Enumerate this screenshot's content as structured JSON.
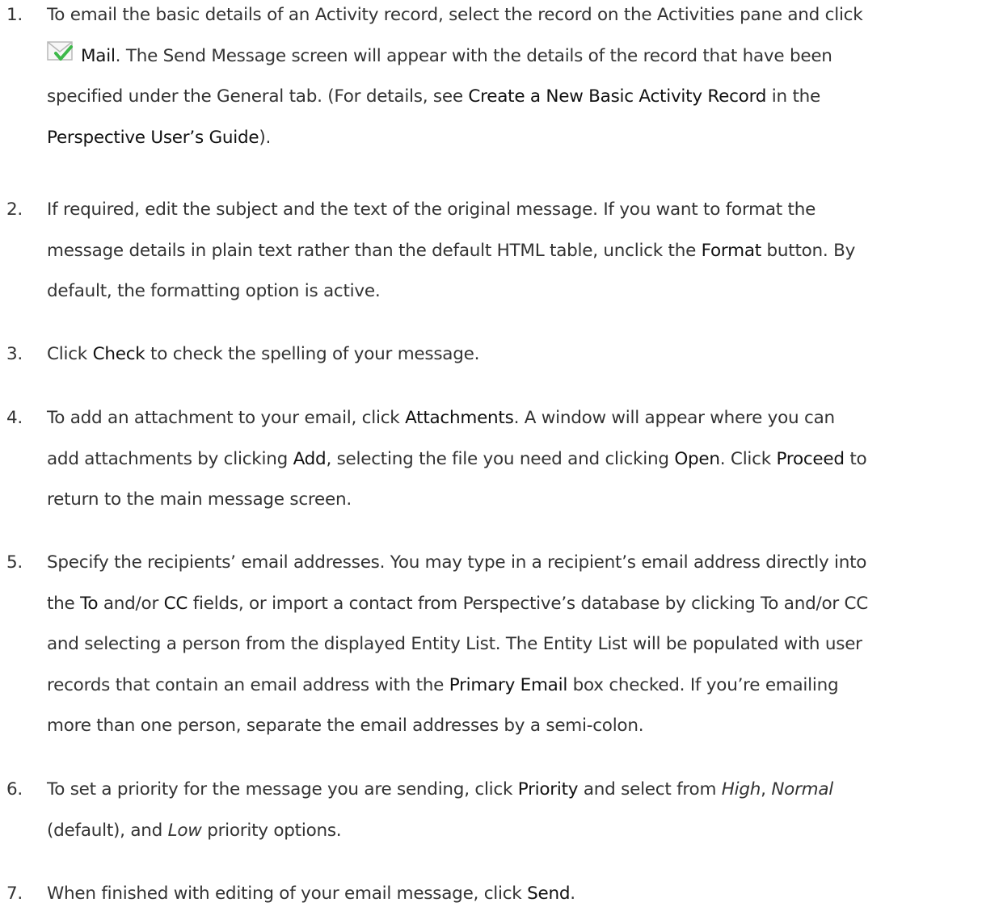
{
  "steps": [
    {
      "number": "1.",
      "l1": "To email the basic details of an Activity record, select the record on the Activities pane and click",
      "icon": "mail-icon",
      "mail": "Mail",
      "l2_rest": ". The Send Message screen will appear with the details of the record that have been",
      "l3_pre": "specified under the General tab. (For details, see ",
      "l3_link": "Create a New Basic Activity Record",
      "l3_post": " in the",
      "l4_link": "Perspective User’s Guide",
      "l4_post": ")."
    },
    {
      "number": "2.",
      "l1": "If required, edit the subject and the text of the original message. If you want to format the",
      "l2_pre": "message details in plain text rather than the default HTML table, unclick the ",
      "l2_bold": "Format",
      "l2_post": " button. By",
      "l3": "default, the formatting option is active."
    },
    {
      "number": "3.",
      "pre": "Click ",
      "bold": "Check",
      "post": " to check the spelling of your message."
    },
    {
      "number": "4.",
      "l1_pre": "To add an attachment to your email, click ",
      "l1_bold": "Attachments",
      "l1_post": ". A window will appear where you can",
      "l2_a": "add attachments by clicking ",
      "l2_b1": "Add",
      "l2_c": ", selecting the file you need and clicking ",
      "l2_b2": "Open",
      "l2_d": ". Click ",
      "l2_b3": "Proceed",
      "l2_e": " to",
      "l3": "return to the main message screen."
    },
    {
      "number": "5.",
      "l1": "Specify the recipients’ email addresses. You may type in a recipient’s email address directly into",
      "l2_a": "the ",
      "l2_to": "To",
      "l2_b": " and/or ",
      "l2_cc": "CC",
      "l2_c": " fields, or import a contact from Perspective’s database by clicking To and/or CC",
      "l3": "and selecting a person from the displayed Entity List. The Entity List will be populated with user",
      "l4_pre": "records that contain an email address with the ",
      "l4_bold": "Primary Email",
      "l4_post": " box checked. If you’re emailing",
      "l5": "more than one person, separate the email addresses by a semi-colon."
    },
    {
      "number": "6.",
      "l1_a": "To set a priority for the message you are sending, click ",
      "l1_bold": "Priority",
      "l1_b": " and select from ",
      "l1_high": "High",
      "l1_c": ", ",
      "l1_normal": "Normal",
      "l2_a": "(default), and ",
      "l2_low": "Low",
      "l2_b": " priority options."
    },
    {
      "number": "7.",
      "pre": "When finished with editing of your email message, click ",
      "bold": "Send",
      "post": "."
    }
  ]
}
